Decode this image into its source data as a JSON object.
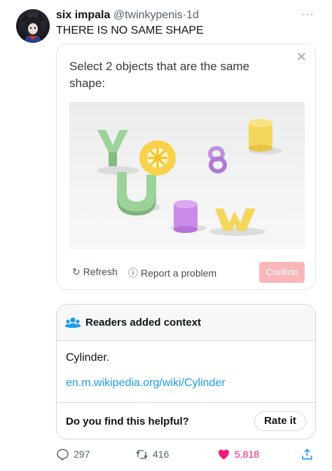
{
  "tweet": {
    "author_name": "six impala",
    "author_handle": "@twinkypenis",
    "separator": "·",
    "time": "1d",
    "text": "THERE IS NO SAME SHAPE",
    "more_icon": "more-horizontal-icon"
  },
  "captcha": {
    "prompt": "Select 2 objects that are the same shape:",
    "close_icon": "close-icon",
    "refresh_label": "Refresh",
    "report_label": "Report a problem",
    "confirm_label": "Confirm",
    "confirm_color": "#f9b7b9"
  },
  "community_note": {
    "title": "Readers added context",
    "body": "Cylinder.",
    "link": "en.m.wikipedia.org/wiki/Cylinder",
    "helpful_question": "Do you find this helpful?",
    "rate_label": "Rate it"
  },
  "actions": {
    "replies": "297",
    "retweets": "416",
    "likes": "5,818",
    "like_color": "#f91880",
    "link_color": "#1d9bf0"
  }
}
